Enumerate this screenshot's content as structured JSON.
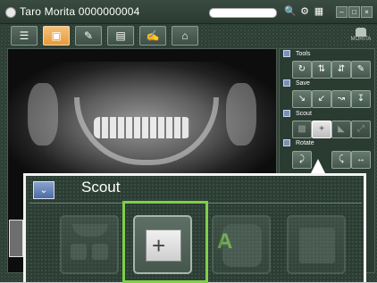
{
  "window": {
    "title": "Taro Morita  0000000004",
    "search_value": ""
  },
  "toolbar": {
    "buttons": [
      {
        "icon": "patient-list-icon"
      },
      {
        "icon": "image-view-icon"
      },
      {
        "icon": "image-tools-icon"
      },
      {
        "icon": "xray-unit-icon"
      },
      {
        "icon": "report-edit-icon"
      },
      {
        "icon": "home-icon"
      }
    ],
    "logo": "MORITA"
  },
  "panel": {
    "tools_label": "Tools",
    "save_label": "Save",
    "scout_label": "Scout",
    "rotate_label": "Rotate"
  },
  "popup": {
    "title": "Scout",
    "callout": "A"
  },
  "colors": {
    "highlight": "#7fcf4a",
    "frame": "#2c3d34"
  }
}
